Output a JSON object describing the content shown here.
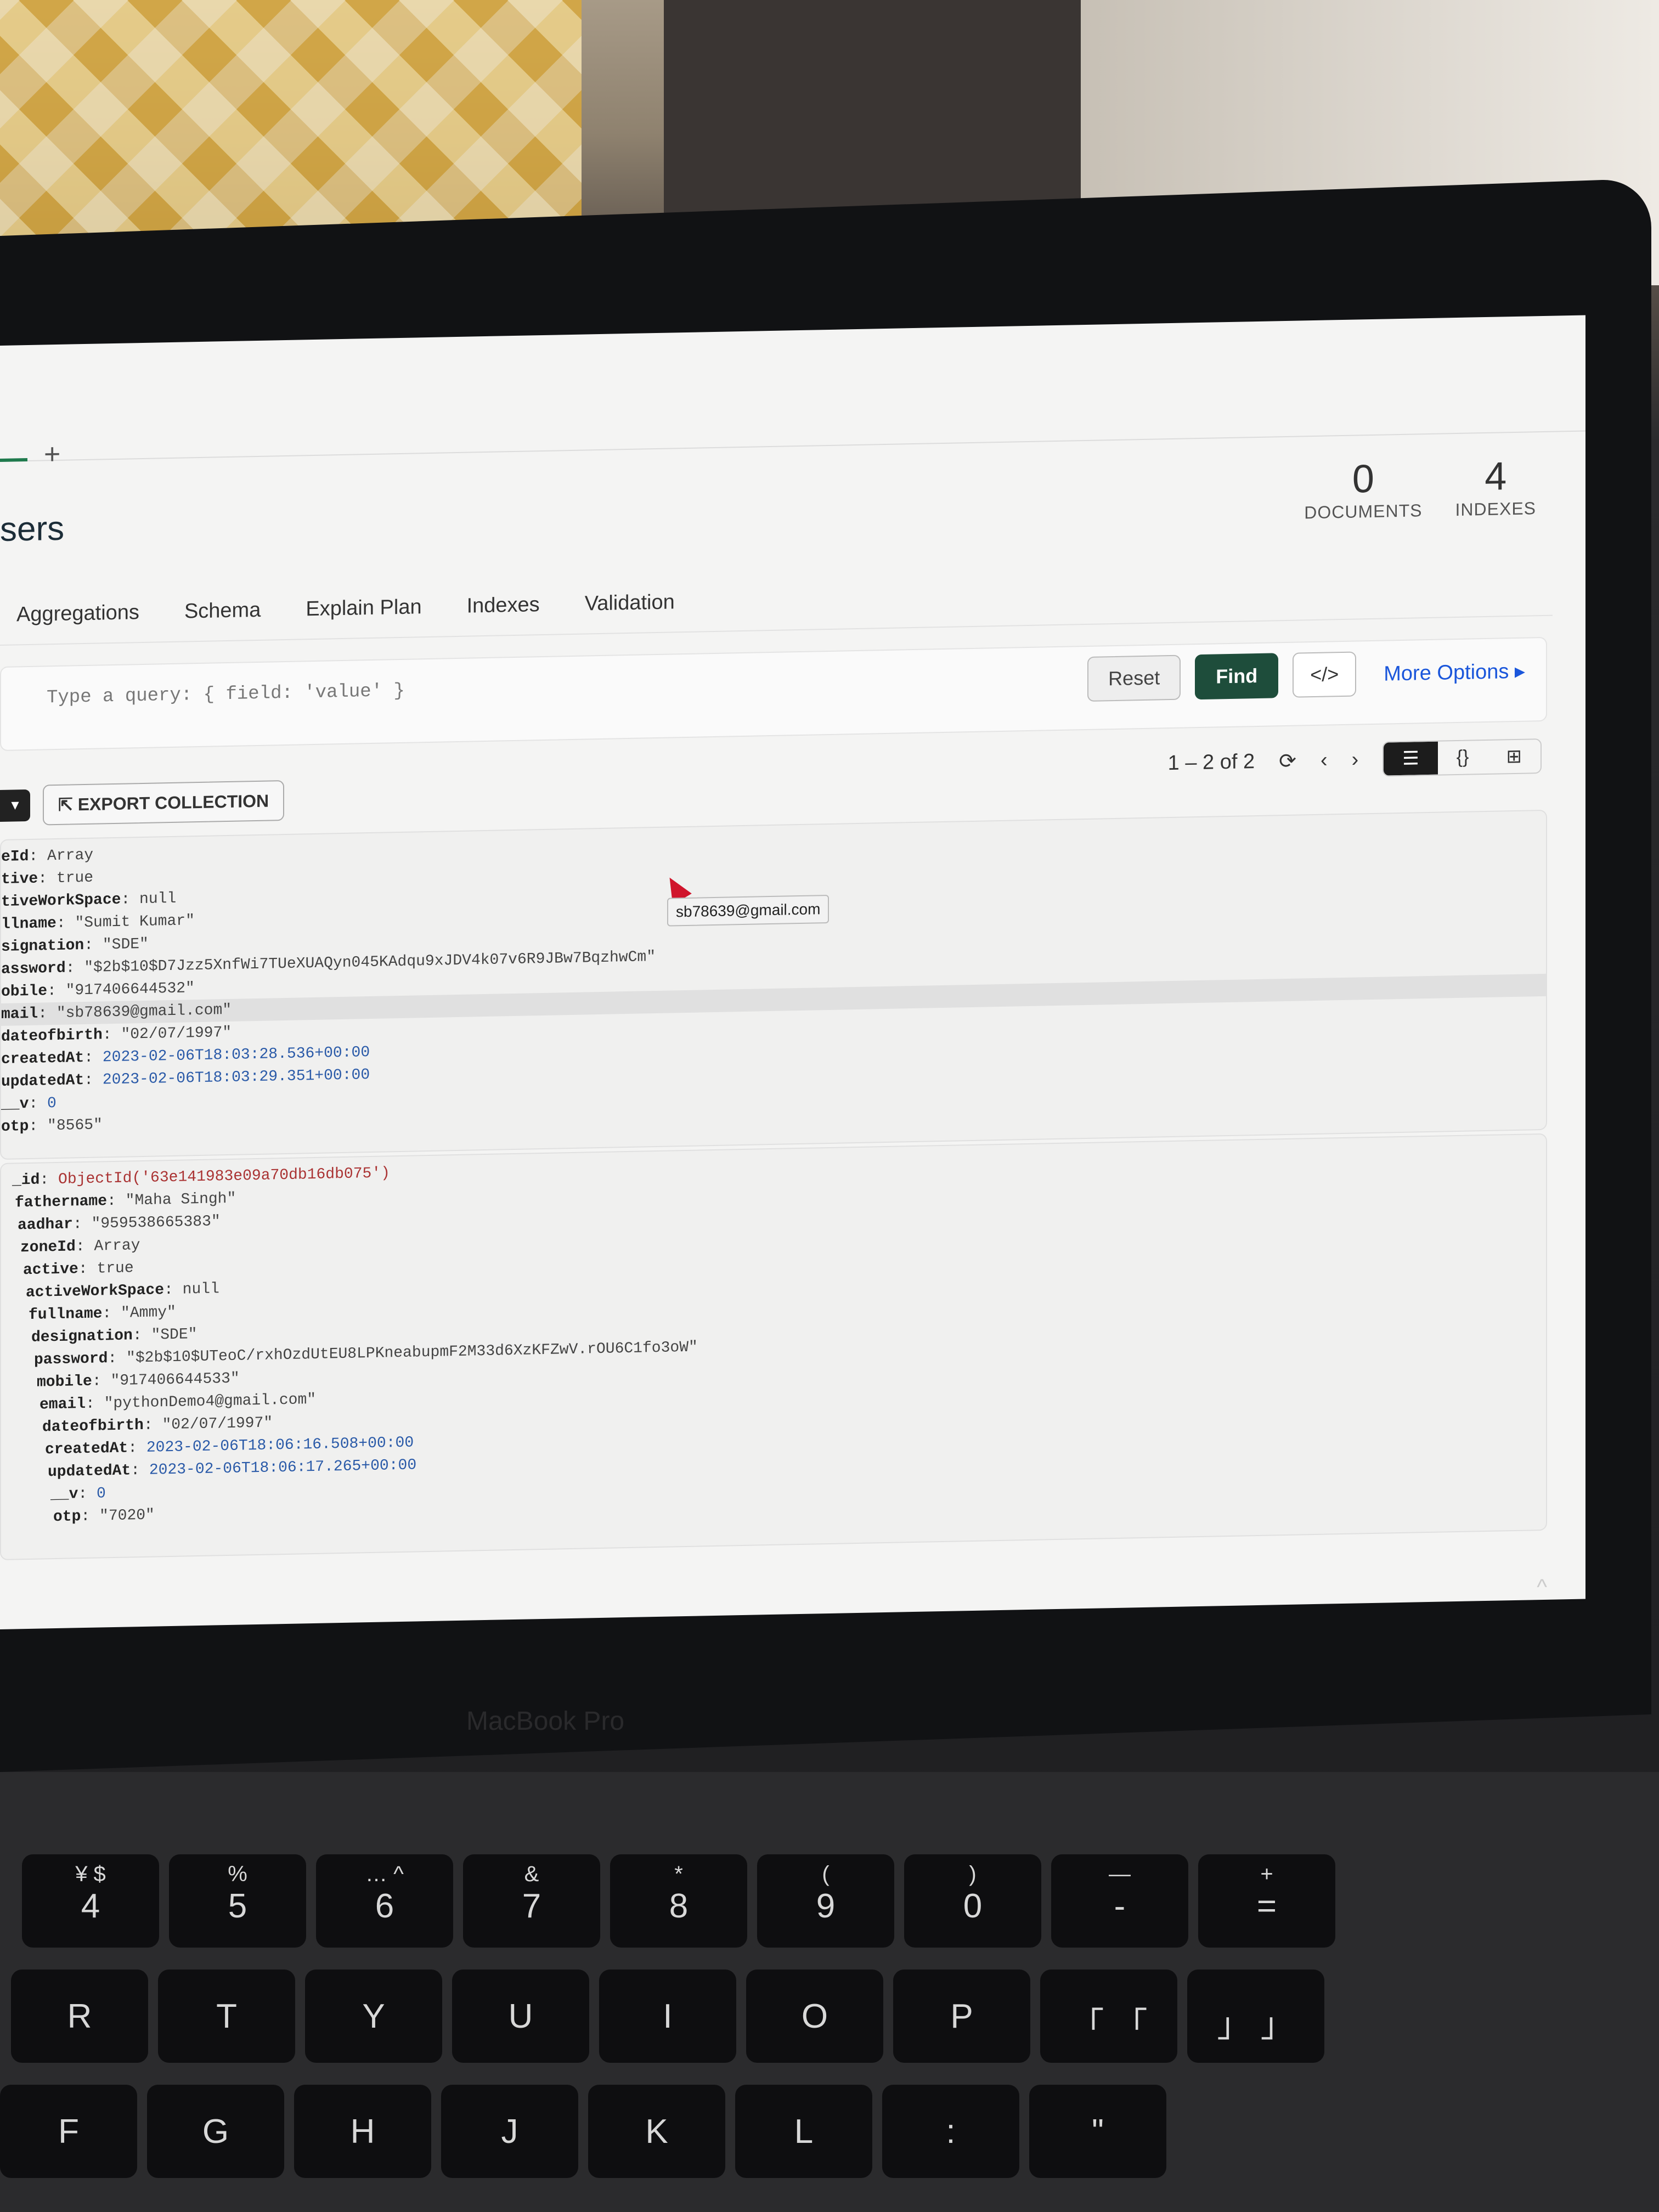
{
  "tabs": {
    "add_label": "+"
  },
  "collection": {
    "title": "sers"
  },
  "stats": {
    "documents": {
      "value": "0",
      "label": "DOCUMENTS"
    },
    "indexes": {
      "value": "4",
      "label": "INDEXES"
    }
  },
  "nav": {
    "items": [
      "Aggregations",
      "Schema",
      "Explain Plan",
      "Indexes",
      "Validation"
    ]
  },
  "query": {
    "placeholder": "Type a query: { field: 'value' }",
    "reset_label": "Reset",
    "find_label": "Find",
    "code_label": "</>",
    "more_options_label": "More Options"
  },
  "toolbar": {
    "export_label": "EXPORT COLLECTION",
    "pagination": "1 – 2 of 2"
  },
  "view_modes": [
    "list-view",
    "json-view",
    "table-view"
  ],
  "documents": [
    {
      "lines": [
        {
          "key": "eId",
          "value": "Array"
        },
        {
          "key": "tive",
          "value": "true"
        },
        {
          "key": "tiveWorkSpace",
          "value": "null"
        },
        {
          "key": "llname",
          "value": "\"Sumit Kumar\""
        },
        {
          "key": "signation",
          "value": "\"SDE\""
        },
        {
          "key": "assword",
          "value": "\"$2b$10$D7Jzz5XnfWi7TUeXUAQyn045KAdqu9xJDV4k07v6R9JBw7BqzhwCm\""
        },
        {
          "key": "obile",
          "value": "\"917406644532\""
        },
        {
          "key": "mail",
          "value": "\"sb78639@gmail.com\""
        },
        {
          "key": "dateofbirth",
          "value": "\"02/07/1997\""
        },
        {
          "key": "createdAt",
          "value": "2023-02-06T18:03:28.536+00:00"
        },
        {
          "key": "updatedAt",
          "value": "2023-02-06T18:03:29.351+00:00"
        },
        {
          "key": "__v",
          "value": "0"
        },
        {
          "key": "otp",
          "value": "\"8565\""
        }
      ]
    },
    {
      "lines": [
        {
          "key": "_id",
          "value": "ObjectId('63e141983e09a70db16db075')"
        },
        {
          "key": "fathername",
          "value": "\"Maha Singh\""
        },
        {
          "key": "aadhar",
          "value": "\"959538665383\""
        },
        {
          "key": "zoneId",
          "value": "Array"
        },
        {
          "key": "active",
          "value": "true"
        },
        {
          "key": "activeWorkSpace",
          "value": "null"
        },
        {
          "key": "fullname",
          "value": "\"Ammy\""
        },
        {
          "key": "designation",
          "value": "\"SDE\""
        },
        {
          "key": "password",
          "value": "\"$2b$10$UTeoC/rxhOzdUtEU8LPKneabupmF2M33d6XzKFZwV.rOU6C1fo3oW\""
        },
        {
          "key": "mobile",
          "value": "\"917406644533\""
        },
        {
          "key": "email",
          "value": "\"pythonDemo4@gmail.com\""
        },
        {
          "key": "dateofbirth",
          "value": "\"02/07/1997\""
        },
        {
          "key": "createdAt",
          "value": "2023-02-06T18:06:16.508+00:00"
        },
        {
          "key": "updatedAt",
          "value": "2023-02-06T18:06:17.265+00:00"
        },
        {
          "key": "__v",
          "value": "0"
        },
        {
          "key": "otp",
          "value": "\"7020\""
        }
      ]
    }
  ],
  "tooltip": {
    "text": "sb78639@gmail.com"
  },
  "laptop": {
    "brand": "MacBook Pro"
  },
  "keyboard": {
    "number_row": [
      {
        "top": "¥ $",
        "main": "4"
      },
      {
        "top": "%",
        "main": "5"
      },
      {
        "top": "… ^",
        "main": "6"
      },
      {
        "top": "&",
        "main": "7"
      },
      {
        "top": "*",
        "main": "8"
      },
      {
        "top": "(",
        "main": "9"
      },
      {
        "top": ")",
        "main": "0"
      },
      {
        "top": "—",
        "main": "-"
      },
      {
        "top": "+",
        "main": "="
      }
    ],
    "letter_row_1": [
      "R",
      "T",
      "Y",
      "U",
      "I",
      "O",
      "P",
      "「 「",
      "」 」"
    ],
    "letter_row_2": [
      "F",
      "G",
      "H",
      "J",
      "K",
      "L",
      ":",
      "\""
    ]
  }
}
